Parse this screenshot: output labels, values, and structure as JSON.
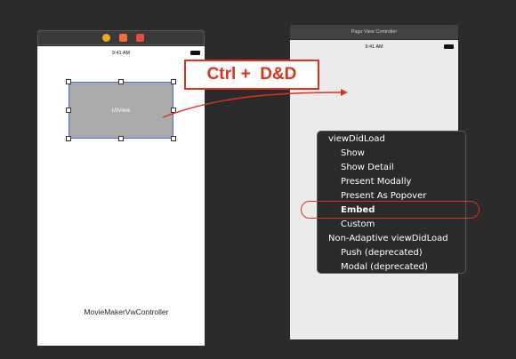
{
  "left_scene": {
    "dock_icons": [
      "view-controller-icon",
      "first-responder-icon",
      "exit-icon"
    ],
    "status_time": "9:41 AM",
    "uiview_label": "UIView",
    "controller_name": "MovieMakerVwController"
  },
  "right_scene": {
    "title": "Page View Controller",
    "status_time": "9:41 AM"
  },
  "callout": {
    "text": "Ctrl +  D&D"
  },
  "segue_menu": {
    "section1": "viewDidLoad",
    "items1": [
      "Show",
      "Show Detail",
      "Present Modally",
      "Present As Popover",
      "Embed",
      "Custom"
    ],
    "section2": "Non-Adaptive viewDidLoad",
    "items2": [
      "Push (deprecated)",
      "Modal (deprecated)"
    ],
    "selected": "Embed"
  },
  "colors": {
    "accent_red": "#e0301e",
    "selection_blue": "#4a6cd4"
  }
}
